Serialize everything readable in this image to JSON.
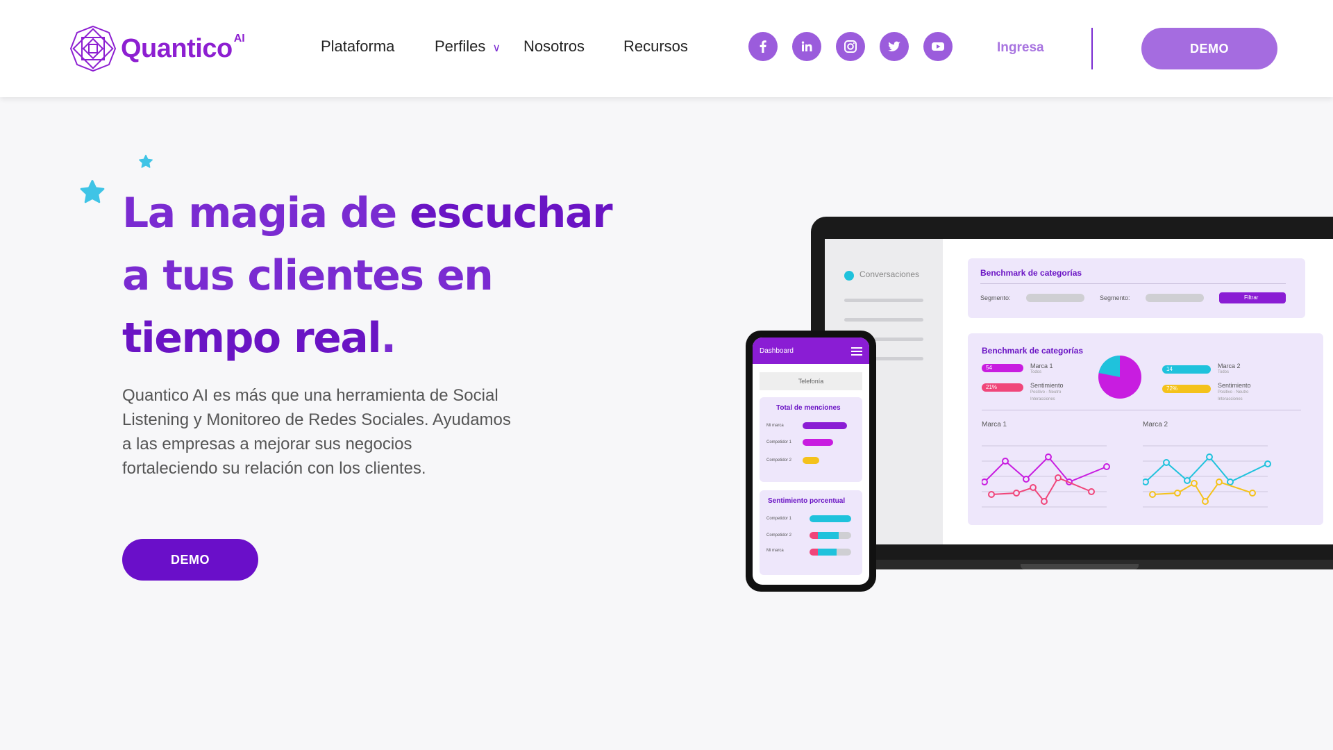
{
  "brand": {
    "name": "Quantico",
    "sup": "AI"
  },
  "nav": {
    "items": [
      "Plataforma",
      "Perfiles",
      "Nosotros",
      "Recursos"
    ],
    "perfiles_chevron": "∨"
  },
  "socials": [
    "facebook-icon",
    "linkedin-icon",
    "instagram-icon",
    "twitter-icon",
    "youtube-icon"
  ],
  "header": {
    "login_label": "Ingresa",
    "demo_label": "DEMO"
  },
  "hero": {
    "headline_1": "La magia de ",
    "headline_1_bold": "escuchar",
    "headline_2": "a tus clientes en",
    "headline_3_bold": "tiempo real",
    "headline_3_end": ".",
    "description": "Quantico AI es más que una herramienta de Social Listening y Monitoreo de Redes Sociales. Ayudamos a las empresas a mejorar sus negocios fortaleciendo su relación con los clientes.",
    "demo_label": "DEMO"
  },
  "laptop": {
    "sidebar_title": "Conversaciones",
    "panel1_title": "Benchmark de categorías",
    "segment_label_1": "Segmento:",
    "segment_label_2": "Segmento:",
    "filter_label": "Filtrar",
    "panel2_title": "Benchmark de categorías",
    "brand1": "Marca 1",
    "brand2": "Marca 2",
    "brand1_sub": "Todos",
    "brand2_sub": "Todos",
    "sentiment_label": "Sentimiento",
    "sentiment_sub": "Positivo - Neutro",
    "interactions_label": "Interacciones",
    "v54": "54",
    "v14": "14",
    "v21": "21%",
    "v72": "72%",
    "chart1_label": "Marca 1",
    "chart2_label": "Marca 2"
  },
  "phone": {
    "title": "Dashboard",
    "tab": "Telefonía",
    "card1_title": "Total de menciones",
    "row1": "Mi marca",
    "row2": "Competidor 1",
    "row3": "Competidor 2",
    "card2_title": "Sentimiento porcentual",
    "row4": "Competidor 1",
    "row5": "Competidor 2",
    "row6": "Mi marca"
  },
  "colors": {
    "brand_purple": "#8d1fd1",
    "deep_purple": "#6a0fc9",
    "light_purple": "#a56ce0",
    "star_cyan": "#3fc4e6",
    "magenta": "#c81de0",
    "cyan": "#1fc2dc",
    "yellow": "#f4c21b",
    "pink": "#f0467a"
  }
}
